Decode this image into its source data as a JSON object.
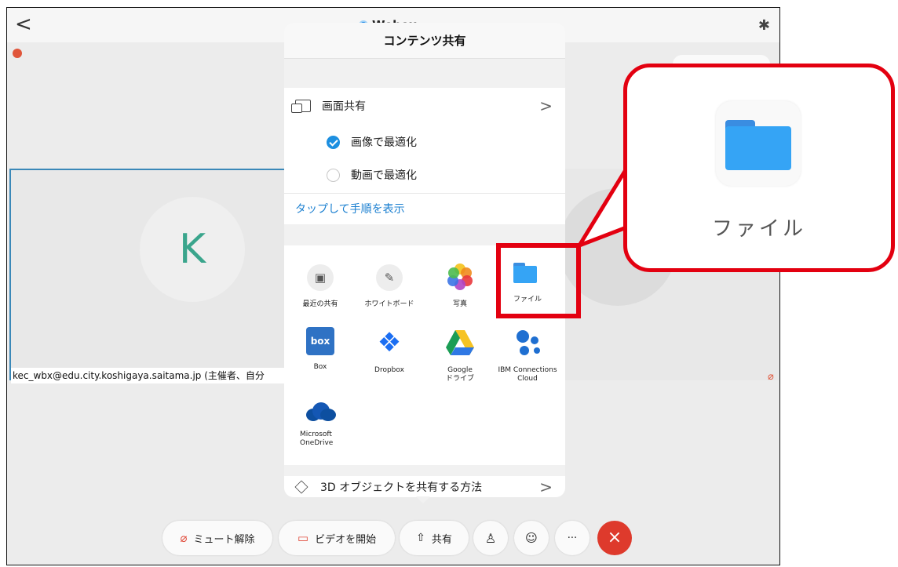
{
  "topbar": {
    "back_glyph": "<",
    "app_title": "Webex",
    "title_chevron": "⌄",
    "bluetooth_glyph": "✱"
  },
  "participant": {
    "initial": "K",
    "name": "kec_wbx@edu.city.koshigaya.saitama.jp (主催者、自分"
  },
  "popup": {
    "title": "コンテンツ共有",
    "screen_share": {
      "label": "画面共有",
      "options": [
        {
          "label": "画像で最適化",
          "selected": true
        },
        {
          "label": "動画で最適化",
          "selected": false
        }
      ],
      "instructions_link": "タップして手順を表示"
    },
    "apps": [
      {
        "label": "最近の共有"
      },
      {
        "label": "ホワイトボード"
      },
      {
        "label": "写真"
      },
      {
        "label": "ファイル"
      },
      {
        "label": "Box"
      },
      {
        "label": "Dropbox"
      },
      {
        "label": "Google\nドライブ"
      },
      {
        "label": "IBM Connections\nCloud"
      },
      {
        "label": "Microsoft\nOneDrive"
      }
    ],
    "three_d": "3D オブジェクトを共有する方法",
    "chevron": ">"
  },
  "callout": {
    "label": "ファイル"
  },
  "toolbar": {
    "unmute": "ミュート解除",
    "start_video": "ビデオを開始",
    "share": "共有",
    "more": "···",
    "end": "×"
  },
  "colors": {
    "accent": "#1d8fe0",
    "highlight_red": "#e30010",
    "end_call": "#de3a2c",
    "link": "#1a7fd0"
  }
}
